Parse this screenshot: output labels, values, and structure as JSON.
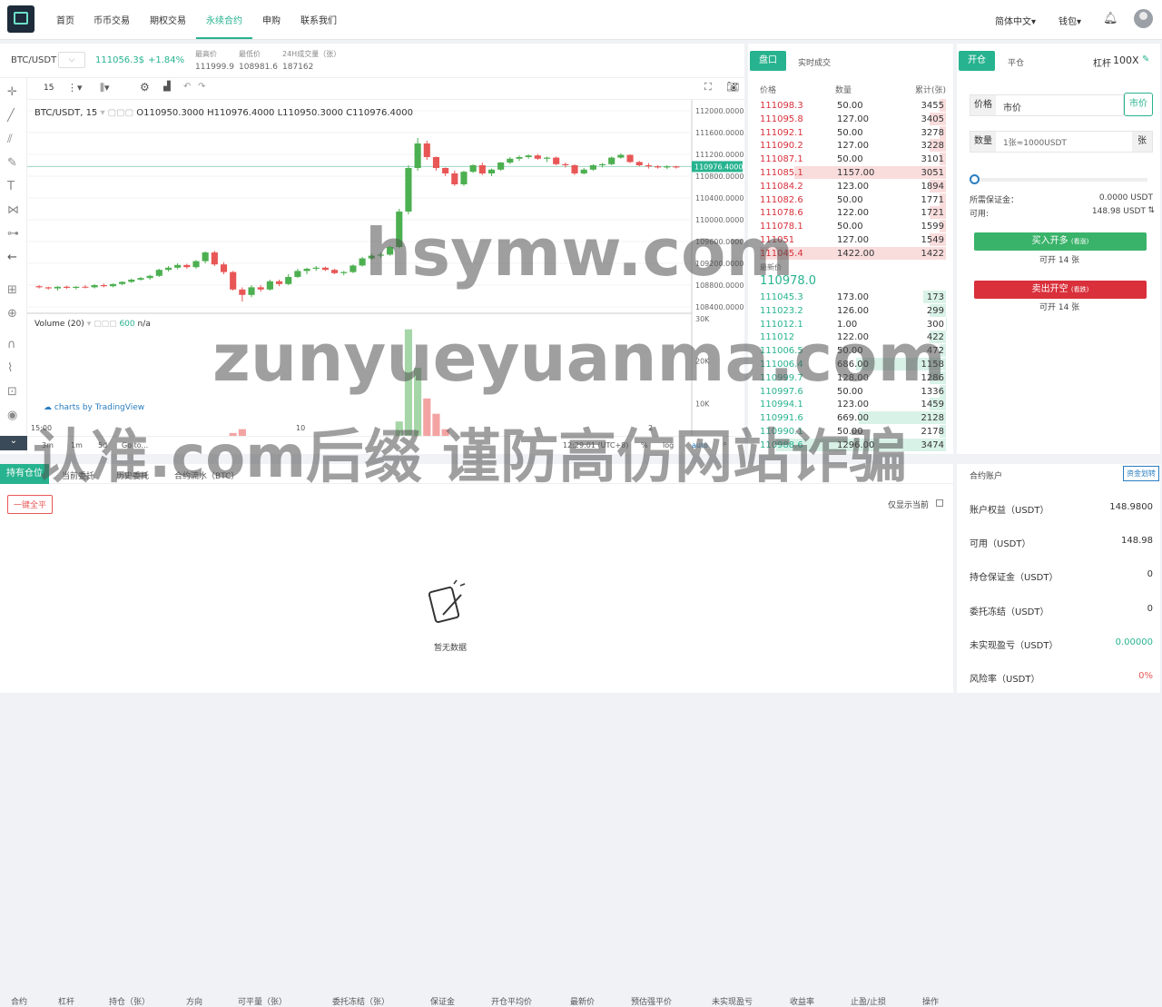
{
  "nav": {
    "items": [
      "首页",
      "币币交易",
      "期权交易",
      "永续合约",
      "申购",
      "联系我们"
    ],
    "lang": "简体中文▾",
    "wallet": "钱包▾"
  },
  "ticker": {
    "pair": "BTC/USDT",
    "price": "111056.3$",
    "change": "+1.84%",
    "high_label": "最高价",
    "high": "111999.9",
    "low_label": "最低价",
    "low": "108981.6",
    "vol_label": "24H成交量（张）",
    "vol": "187162"
  },
  "toolbar": {
    "interval": "15"
  },
  "chart": {
    "legend": "BTC/USDT, 15",
    "o": "O110950.3000",
    "h": "H110976.4000",
    "l": "L110950.3000",
    "c": "C110976.4000",
    "volume_label": "Volume (20)",
    "volume_val": "600",
    "volume_na": "n/a",
    "attribution": "charts by TradingView",
    "last_price": "110976.4000",
    "xaxis": [
      "15:00",
      "10",
      "2"
    ],
    "ranges": [
      "3m",
      "1m",
      "5d",
      "Go to..."
    ],
    "time": "12:29:01 (UTC+8)",
    "modes": [
      "%",
      "log",
      "auto"
    ]
  },
  "chart_data": {
    "type": "candlestick",
    "y_ticks": [
      112000,
      111600,
      111200,
      110800,
      110400,
      110000,
      109600,
      109200,
      108800,
      108400
    ],
    "volume_ticks": [
      "30K",
      "20K",
      "10K",
      "0"
    ],
    "candles": [
      [
        108780,
        108800,
        108740,
        108760
      ],
      [
        108760,
        108770,
        108720,
        108740
      ],
      [
        108740,
        108780,
        108700,
        108770
      ],
      [
        108770,
        108790,
        108730,
        108750
      ],
      [
        108750,
        108780,
        108720,
        108770
      ],
      [
        108770,
        108800,
        108740,
        108760
      ],
      [
        108760,
        108820,
        108740,
        108800
      ],
      [
        108800,
        108830,
        108760,
        108780
      ],
      [
        108780,
        108830,
        108760,
        108820
      ],
      [
        108820,
        108870,
        108800,
        108860
      ],
      [
        108860,
        108920,
        108840,
        108900
      ],
      [
        108900,
        108950,
        108880,
        108930
      ],
      [
        108930,
        108990,
        108900,
        108970
      ],
      [
        108970,
        109100,
        108950,
        109080
      ],
      [
        109080,
        109150,
        109050,
        109120
      ],
      [
        109120,
        109200,
        109090,
        109170
      ],
      [
        109170,
        109190,
        109100,
        109130
      ],
      [
        109130,
        109260,
        109100,
        109240
      ],
      [
        109240,
        109420,
        109200,
        109400
      ],
      [
        109400,
        109430,
        109150,
        109180
      ],
      [
        109180,
        109220,
        109000,
        109040
      ],
      [
        109040,
        109060,
        108700,
        108720
      ],
      [
        108720,
        108760,
        108500,
        108620
      ],
      [
        108620,
        108800,
        108580,
        108760
      ],
      [
        108760,
        108800,
        108680,
        108720
      ],
      [
        108720,
        108900,
        108700,
        108870
      ],
      [
        108870,
        108900,
        108780,
        108820
      ],
      [
        108820,
        109000,
        108800,
        108950
      ],
      [
        108950,
        109100,
        108930,
        109060
      ],
      [
        109060,
        109120,
        109000,
        109100
      ],
      [
        109100,
        109150,
        109060,
        109120
      ],
      [
        109120,
        109140,
        109060,
        109080
      ],
      [
        109080,
        109100,
        109000,
        109020
      ],
      [
        109020,
        109060,
        108980,
        109040
      ],
      [
        109040,
        109180,
        109020,
        109160
      ],
      [
        109160,
        109320,
        109140,
        109290
      ],
      [
        109290,
        109380,
        109260,
        109340
      ],
      [
        109340,
        109400,
        109300,
        109360
      ],
      [
        109360,
        109520,
        109340,
        109500
      ],
      [
        109500,
        110200,
        109480,
        110150
      ],
      [
        110150,
        111000,
        110100,
        110950
      ],
      [
        110950,
        111500,
        110900,
        111400
      ],
      [
        111400,
        111450,
        111100,
        111150
      ],
      [
        111150,
        111160,
        110900,
        110950
      ],
      [
        110950,
        110960,
        110800,
        110850
      ],
      [
        110850,
        110900,
        110620,
        110650
      ],
      [
        110650,
        110900,
        110620,
        110880
      ],
      [
        110880,
        111020,
        110860,
        111000
      ],
      [
        111000,
        111050,
        110820,
        110850
      ],
      [
        110850,
        110940,
        110800,
        110920
      ],
      [
        110920,
        111060,
        110900,
        111050
      ],
      [
        111050,
        111150,
        111020,
        111120
      ],
      [
        111120,
        111180,
        111080,
        111150
      ],
      [
        111150,
        111200,
        111120,
        111180
      ],
      [
        111180,
        111210,
        111100,
        111120
      ],
      [
        111120,
        111160,
        111060,
        111140
      ],
      [
        111140,
        111160,
        111000,
        111020
      ],
      [
        111020,
        111050,
        110960,
        111000
      ],
      [
        111000,
        111020,
        110820,
        110850
      ],
      [
        110850,
        110950,
        110830,
        110920
      ],
      [
        110920,
        111020,
        110900,
        111000
      ],
      [
        111000,
        111040,
        110960,
        111020
      ],
      [
        111020,
        111160,
        111000,
        111140
      ],
      [
        111140,
        111220,
        111120,
        111190
      ],
      [
        111190,
        111200,
        111040,
        111060
      ],
      [
        111060,
        111080,
        110980,
        111000
      ],
      [
        111000,
        111040,
        110940,
        110980
      ],
      [
        110980,
        111000,
        110940,
        110960
      ],
      [
        110960,
        111000,
        110930,
        110980
      ],
      [
        110980,
        110990,
        110940,
        110960
      ]
    ],
    "volumes": [
      2,
      1,
      1,
      2,
      1,
      1,
      1,
      1,
      2,
      1,
      1,
      2,
      2,
      3,
      2,
      2,
      1,
      2,
      3,
      3,
      4,
      5,
      6,
      3,
      3,
      2,
      2,
      2,
      2,
      1,
      1,
      2,
      1,
      1,
      2,
      2,
      1,
      2,
      3,
      8,
      32,
      22,
      14,
      10,
      6,
      4,
      3,
      2,
      2,
      2,
      2,
      1,
      1,
      2,
      2,
      1,
      2,
      1,
      3,
      2,
      1,
      1,
      2,
      4,
      2,
      1,
      1,
      1,
      1,
      1
    ]
  },
  "orderbook": {
    "tabs": [
      "盘口",
      "实时成交"
    ],
    "headers": [
      "价格",
      "数量",
      "累计(张)"
    ],
    "asks": [
      [
        "111098.3",
        "50.00",
        "3455"
      ],
      [
        "111095.8",
        "127.00",
        "3405"
      ],
      [
        "111092.1",
        "50.00",
        "3278"
      ],
      [
        "111090.2",
        "127.00",
        "3228"
      ],
      [
        "111087.1",
        "50.00",
        "3101"
      ],
      [
        "111085.1",
        "1157.00",
        "3051"
      ],
      [
        "111084.2",
        "123.00",
        "1894"
      ],
      [
        "111082.6",
        "50.00",
        "1771"
      ],
      [
        "111078.6",
        "122.00",
        "1721"
      ],
      [
        "111078.1",
        "50.00",
        "1599"
      ],
      [
        "111051",
        "127.00",
        "1549"
      ],
      [
        "111045.4",
        "1422.00",
        "1422"
      ]
    ],
    "latest_label": "最新价",
    "latest": "110978.0",
    "bids": [
      [
        "111045.3",
        "173.00",
        "173"
      ],
      [
        "111023.2",
        "126.00",
        "299"
      ],
      [
        "111012.1",
        "1.00",
        "300"
      ],
      [
        "111012",
        "122.00",
        "422"
      ],
      [
        "111006.5",
        "50.00",
        "472"
      ],
      [
        "111006.4",
        "686.00",
        "1158"
      ],
      [
        "110999.7",
        "128.00",
        "1286"
      ],
      [
        "110997.6",
        "50.00",
        "1336"
      ],
      [
        "110994.1",
        "123.00",
        "1459"
      ],
      [
        "110991.6",
        "669.00",
        "2128"
      ],
      [
        "110990.1",
        "50.00",
        "2178"
      ],
      [
        "110988.6",
        "1296.00",
        "3474"
      ]
    ]
  },
  "trade": {
    "tab_open": "开仓",
    "tab_close": "平仓",
    "leverage_label": "杠杆",
    "leverage": "100X",
    "price_label": "价格",
    "price_value": "市价",
    "price_mode": "市价",
    "qty_label": "数量",
    "qty_placeholder": "1张≈1000USDT",
    "qty_unit": "张",
    "margin_label": "所需保证金：",
    "margin_value": "0.0000 USDT",
    "avail_label": "可用:",
    "avail_value": "148.98 USDT",
    "buy_label": "买入开多",
    "buy_sub": "(看涨)",
    "buy_can": "可开 14 张",
    "sell_label": "卖出开空",
    "sell_sub": "(看跌)",
    "sell_can": "可开 14 张"
  },
  "positions": {
    "tabs": [
      "持有仓位",
      "当前委托",
      "历史委托",
      "合约流水（BTC）"
    ],
    "close_all": "一键全平",
    "only_current": "仅显示当前",
    "columns": [
      "合约",
      "杠杆",
      "持仓（张）",
      "方向",
      "可平量（张）",
      "委托冻结（张）",
      "保证金",
      "开仓平均价",
      "最新价",
      "预估强平价",
      "未实现盈亏",
      "收益率",
      "止盈/止损",
      "操作"
    ],
    "empty": "暂无数据"
  },
  "account": {
    "title": "合约账户",
    "transfer": "资金划转",
    "rows": [
      [
        "账户权益（USDT）",
        "148.9800"
      ],
      [
        "可用（USDT）",
        "148.98"
      ],
      [
        "持仓保证金（USDT）",
        "0"
      ],
      [
        "委托冻结（USDT）",
        "0"
      ],
      [
        "未实现盈亏（USDT）",
        "0.00000"
      ],
      [
        "风险率（USDT）",
        "0%"
      ]
    ]
  },
  "watermark": {
    "line1": "hsymw.com",
    "line2": "zunyueyuanma.com",
    "line3": "认准.com后缀 谨防高仿网站诈骗"
  },
  "colors": {
    "accent": "#27b38f",
    "up": "#4caf50",
    "down": "#e85656"
  }
}
